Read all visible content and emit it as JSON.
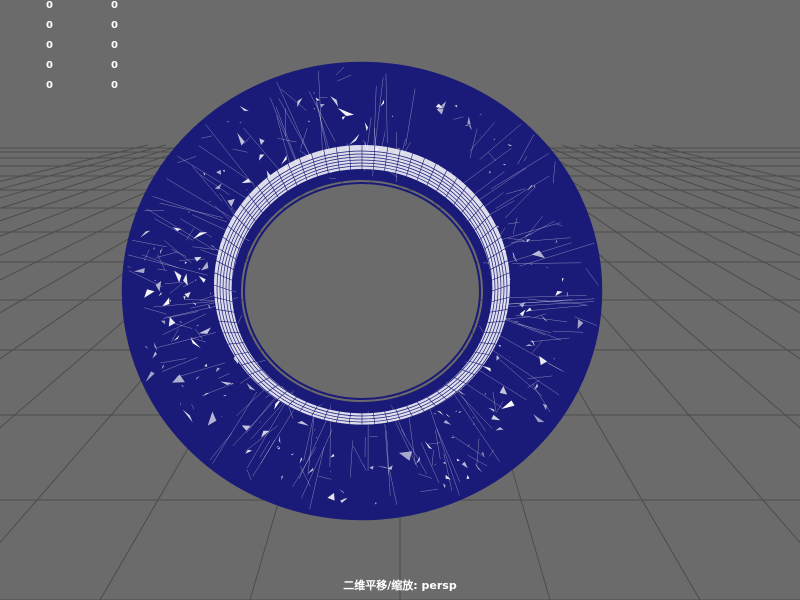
{
  "viewport": {
    "background_color": "#6b6b6b",
    "grid_color": "#4c4c4c",
    "mesh_line_color": "#1a1a78",
    "mesh_fill_color": "#ffffff",
    "camera": "persp",
    "status_text": "二维平移/缩放: persp"
  },
  "hud_stats": [
    {
      "a": "0",
      "b": "0"
    },
    {
      "a": "0",
      "b": "0"
    },
    {
      "a": "0",
      "b": "0"
    },
    {
      "a": "0",
      "b": "0"
    },
    {
      "a": "0",
      "b": "0"
    }
  ],
  "model": {
    "icon": "torus-wireframe-mesh-icon",
    "display_mode": "wireframe"
  }
}
